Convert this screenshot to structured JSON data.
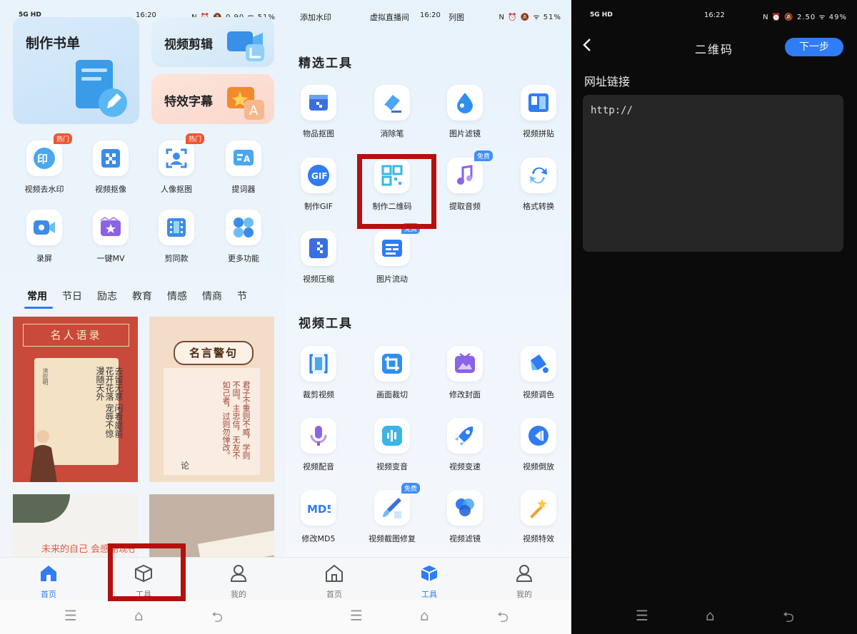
{
  "panel1": {
    "status": {
      "network": "5G HD",
      "time": "16:20",
      "icons": "N ⏰ 🔕 0.90 ᯤ 51%"
    },
    "cards": [
      {
        "title": "制作书单",
        "icon": "document-edit-icon"
      },
      {
        "title": "视频剪辑",
        "icon": "video-crop-icon"
      },
      {
        "title": "特效字幕",
        "icon": "sparkle-text-icon"
      }
    ],
    "tools": [
      {
        "label": "视频去水印",
        "icon": "watermark-icon",
        "badge": "热门"
      },
      {
        "label": "视频抠像",
        "icon": "mosaic-icon",
        "badge": ""
      },
      {
        "label": "人像抠图",
        "icon": "portrait-icon",
        "badge": "热门"
      },
      {
        "label": "提词器",
        "icon": "teleprompter-icon",
        "badge": ""
      },
      {
        "label": "录屏",
        "icon": "screen-record-icon",
        "badge": ""
      },
      {
        "label": "一键MV",
        "icon": "mv-icon",
        "badge": ""
      },
      {
        "label": "剪同款",
        "icon": "film-icon",
        "badge": ""
      },
      {
        "label": "更多功能",
        "icon": "more-grid-icon",
        "badge": ""
      }
    ],
    "tabs": [
      "常用",
      "节日",
      "励志",
      "教育",
      "情感",
      "情商",
      "节"
    ],
    "posters": [
      {
        "title": "名人语录",
        "text": "去留无意 闲看庭前花开花落 宠辱不惊 漫随天外",
        "author": "洪应明"
      },
      {
        "title": "名言警句",
        "text": "君子不重则不威，学则不固。主忠信，无友不如己者，过则勿惮改。",
        "author": "论"
      },
      {
        "title": "未来的自己",
        "text": "未来的自己 会感谢现在努力的你"
      },
      {
        "title": "",
        "text": ""
      }
    ],
    "nav": [
      {
        "label": "首页",
        "icon": "home-icon"
      },
      {
        "label": "工具",
        "icon": "box-icon"
      },
      {
        "label": "我的",
        "icon": "user-icon"
      }
    ]
  },
  "panel2": {
    "status": {
      "left": "添加水印",
      "center": "虚拟直播间",
      "time": "16:20",
      "right": "列图",
      "icons": "N ⏰ 🔕 ᯤ 51%"
    },
    "section1": "精选工具",
    "featured": [
      {
        "label": "物品抠图",
        "icon": "object-cutout-icon",
        "badge": ""
      },
      {
        "label": "消除笔",
        "icon": "eraser-icon",
        "badge": ""
      },
      {
        "label": "图片滤镜",
        "icon": "drop-icon",
        "badge": ""
      },
      {
        "label": "视频拼贴",
        "icon": "collage-icon",
        "badge": ""
      },
      {
        "label": "制作GIF",
        "icon": "gif-icon",
        "badge": ""
      },
      {
        "label": "制作二维码",
        "icon": "qr-code-icon",
        "badge": ""
      },
      {
        "label": "提取音频",
        "icon": "music-note-icon",
        "badge": "免费"
      },
      {
        "label": "格式转换",
        "icon": "convert-icon",
        "badge": ""
      },
      {
        "label": "视频压缩",
        "icon": "compress-icon",
        "badge": ""
      },
      {
        "label": "图片流动",
        "icon": "flow-icon",
        "badge": "免费"
      }
    ],
    "section2": "视频工具",
    "video_tools": [
      {
        "label": "裁剪视频",
        "icon": "trim-icon",
        "badge": ""
      },
      {
        "label": "画面裁切",
        "icon": "crop-icon",
        "badge": ""
      },
      {
        "label": "修改封面",
        "icon": "cover-icon",
        "badge": ""
      },
      {
        "label": "视频调色",
        "icon": "paint-bucket-icon",
        "badge": ""
      },
      {
        "label": "视频配音",
        "icon": "mic-icon",
        "badge": ""
      },
      {
        "label": "视频变音",
        "icon": "voice-wave-icon",
        "badge": ""
      },
      {
        "label": "视频变速",
        "icon": "rocket-icon",
        "badge": ""
      },
      {
        "label": "视频倒放",
        "icon": "rewind-icon",
        "badge": ""
      },
      {
        "label": "修改MD5",
        "icon": "md5-icon",
        "badge": ""
      },
      {
        "label": "视频截图修复",
        "icon": "brush-icon",
        "badge": "免费"
      },
      {
        "label": "视频滤镜",
        "icon": "filter-circles-icon",
        "badge": ""
      },
      {
        "label": "视频特效",
        "icon": "magic-wand-icon",
        "badge": ""
      }
    ],
    "nav": [
      {
        "label": "首页",
        "icon": "home-icon"
      },
      {
        "label": "工具",
        "icon": "box-icon"
      },
      {
        "label": "我的",
        "icon": "user-icon"
      }
    ]
  },
  "panel3": {
    "status": {
      "network": "5G HD",
      "time": "16:22",
      "icons": "N ⏰ 🔕 2.50 ᯤ 49%"
    },
    "title": "二维码",
    "next_label": "下一步",
    "field_label": "网址链接",
    "url_value": "http://"
  },
  "colors": {
    "accent": "#2f7cf6",
    "highlight": "#b4110d",
    "hot": "#f0552e"
  }
}
